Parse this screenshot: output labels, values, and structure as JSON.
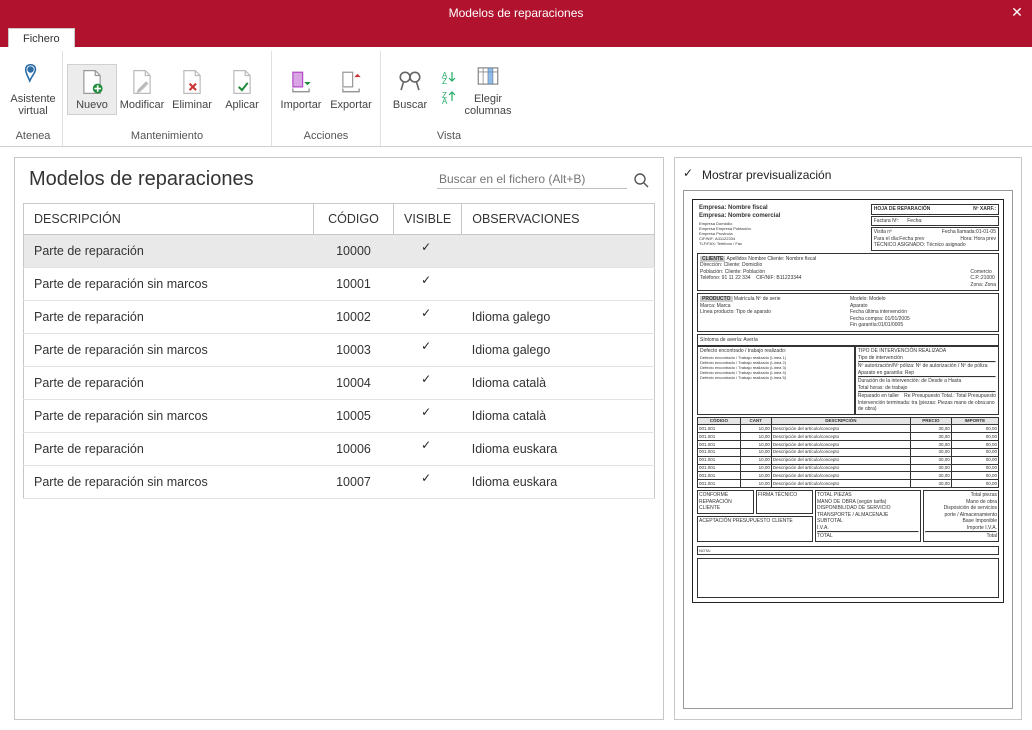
{
  "window": {
    "title": "Modelos de reparaciones"
  },
  "tab": {
    "label": "Fichero"
  },
  "ribbon": {
    "groups": [
      {
        "label": "Atenea",
        "buttons": [
          {
            "name": "asistente-virtual",
            "label": "Asistente\nvirtual"
          }
        ]
      },
      {
        "label": "Mantenimiento",
        "buttons": [
          {
            "name": "nuevo",
            "label": "Nuevo",
            "highlight": true
          },
          {
            "name": "modificar",
            "label": "Modificar"
          },
          {
            "name": "eliminar",
            "label": "Eliminar"
          },
          {
            "name": "aplicar",
            "label": "Aplicar"
          }
        ]
      },
      {
        "label": "Acciones",
        "buttons": [
          {
            "name": "importar",
            "label": "Importar"
          },
          {
            "name": "exportar",
            "label": "Exportar"
          }
        ]
      },
      {
        "label": "Vista",
        "buttons": [
          {
            "name": "buscar",
            "label": "Buscar"
          }
        ],
        "stack": true,
        "extra": [
          {
            "name": "elegir-columnas",
            "label": "Elegir\ncolumnas"
          }
        ]
      }
    ]
  },
  "content": {
    "heading": "Modelos de reparaciones",
    "searchPlaceholder": "Buscar en el fichero (Alt+B)",
    "columns": [
      "DESCRIPCIÓN",
      "CÓDIGO",
      "VISIBLE",
      "OBSERVACIONES"
    ],
    "rows": [
      {
        "desc": "Parte de reparación",
        "code": "10000",
        "visible": true,
        "obs": "",
        "selected": true
      },
      {
        "desc": "Parte de reparación sin marcos",
        "code": "10001",
        "visible": true,
        "obs": ""
      },
      {
        "desc": "Parte de reparación",
        "code": "10002",
        "visible": true,
        "obs": "Idioma galego"
      },
      {
        "desc": "Parte de reparación sin marcos",
        "code": "10003",
        "visible": true,
        "obs": "Idioma galego"
      },
      {
        "desc": "Parte de reparación",
        "code": "10004",
        "visible": true,
        "obs": "Idioma català"
      },
      {
        "desc": "Parte de reparación sin marcos",
        "code": "10005",
        "visible": true,
        "obs": "Idioma català"
      },
      {
        "desc": "Parte de reparación",
        "code": "10006",
        "visible": true,
        "obs": "Idioma euskara"
      },
      {
        "desc": "Parte de reparación sin marcos",
        "code": "10007",
        "visible": true,
        "obs": "Idioma euskara"
      }
    ]
  },
  "preview": {
    "toggleLabel": "Mostrar previsualización",
    "toggleChecked": true,
    "doc": {
      "empresaFiscal": "Empresa: Nombre fiscal",
      "empresaComercial": "Empresa: Nombre comercial",
      "hoja": "HOJA DE REPARACIÓN",
      "nx": "Nº XARF.:",
      "empresaDom": "Empresa Domicilio",
      "empresaPob": "Empresa Empresa Población",
      "empresaProv": "Empresa Provincia",
      "cifnif": "CIF/NIF: A41122334",
      "tlffax": "TLF/FAX: Teléfono    / Fax",
      "factura": "Factura Nº:",
      "fecha": "Fecha:",
      "visita": "Visita nº",
      "fechaLlamada": "Fecha llamada:01-01-05",
      "paraDia": "Para el día:Fecha prev",
      "horaPrev": "Hora: Hora prev",
      "tecnico": "TÉCNICO ASIGNADO: Técnico asignado",
      "cliente": "Apellidos Nombre  Cliente: Nombre fiscal",
      "direccion": "Dirección: Cliente: Domicilio",
      "poblacion": "Población: Cliente: Población",
      "comercio": "Comercio",
      "cp": "C.P.:21000",
      "telefono": "Teléfono: 91 11 22 334",
      "cifnif2": "CIF/NIF: B11223344",
      "zona": "Zona: Zona",
      "producto": "Matrícula Nº de serie",
      "modelo": "Modelo: Modelo",
      "marca": "Marca: Marca",
      "aparato": "Aparato",
      "linea": "Línea producto:  Tipo de aparato",
      "fechaUlt": "Fecha última intervención",
      "fechaCompra": "Fecha compra: 01/01/2005",
      "finGar": "Fin garantía:01/01/0005",
      "sintoma": "Síntoma de avería: Avería",
      "defecto": "Defecto encontrado / trabajo realizado:",
      "defLines": [
        "Defecto encontrado / Trabajo realizado (Línea 1)",
        "Defecto encontrado / Trabajo realizado (Línea 2)",
        "Defecto encontrado / Trabajo realizado (Línea 3)",
        "Defecto encontrado / Trabajo realizado (Línea 4)",
        "Defecto encontrado / Trabajo realizado (Línea 5)"
      ],
      "tipoInt": "TIPO DE INTERVENCIÓN REALIZADA",
      "tipoIntVal": "Tipo de intervención",
      "auth": "Nº autorización/Nº póliza: Nº de autorización / Nº de póliza",
      "apGar": "Aparato en garantía: Rep",
      "dur": "Duración de la intervención: de Desde   a Hasta",
      "horas": "Total horas: de trabajo",
      "reparado": "Reparado en taller",
      "presup": "Re  Presupuesto Total.: Total Presupuesto",
      "intTer": "Intervención terminada: tra (piezas: Piezas  mano de obra:ano de obra)",
      "colHdr": [
        "CÓDIGO",
        "CANT",
        "DESCRIPCIÓN",
        "PRECIO",
        "IMPORTE"
      ],
      "items": [
        {
          "c": "001.001",
          "q": "10,00",
          "d": "Descripción del artículo/concepto",
          "p": "30,00",
          "i": "00,00"
        },
        {
          "c": "001.001",
          "q": "10,00",
          "d": "Descripción del artículo/concepto",
          "p": "30,00",
          "i": "00,00"
        },
        {
          "c": "001.001",
          "q": "10,00",
          "d": "Descripción del artículo/concepto",
          "p": "30,00",
          "i": "00,00"
        },
        {
          "c": "001.001",
          "q": "10,00",
          "d": "Descripción del artículo/concepto",
          "p": "30,00",
          "i": "00,00"
        },
        {
          "c": "001.001",
          "q": "10,00",
          "d": "Descripción del artículo/concepto",
          "p": "30,00",
          "i": "00,00"
        },
        {
          "c": "001.001",
          "q": "10,00",
          "d": "Descripción del artículo/concepto",
          "p": "30,00",
          "i": "00,00"
        },
        {
          "c": "001.001",
          "q": "10,00",
          "d": "Descripción del artículo/concepto",
          "p": "30,00",
          "i": "00,00"
        },
        {
          "c": "001.001",
          "q": "10,00",
          "d": "Descripción del artículo/concepto",
          "p": "30,00",
          "i": "00,00"
        }
      ],
      "conforme": "CONFORME REPARACIÓN CLIENTE",
      "firma": "FIRMA TÉCNICO",
      "aceptar": "ACEPTACIÓN PRESUPUESTO CLIENTE",
      "totals": {
        "piezas": "TOTAL PIEZAS",
        "mano": "MANO DE OBRA (según tarifa)",
        "disp": "DISPONIBILIDAD DE SERVICIO",
        "trans": "TRANSPORTE / ALMACENAJE",
        "sub": "SUBTOTAL",
        "iva": "I.V.A.",
        "total": "TOTAL",
        "tpiezas": "Total piezas",
        "tmano": "Mano de obra",
        "tdisp": "Disposición de servicios",
        "ttrans": "porte / Almacenamiento",
        "tbase": "Base Imponible",
        "tiva": "Importe I.V.A.",
        "ttotal": "Total"
      },
      "nota": "NOTA"
    }
  }
}
